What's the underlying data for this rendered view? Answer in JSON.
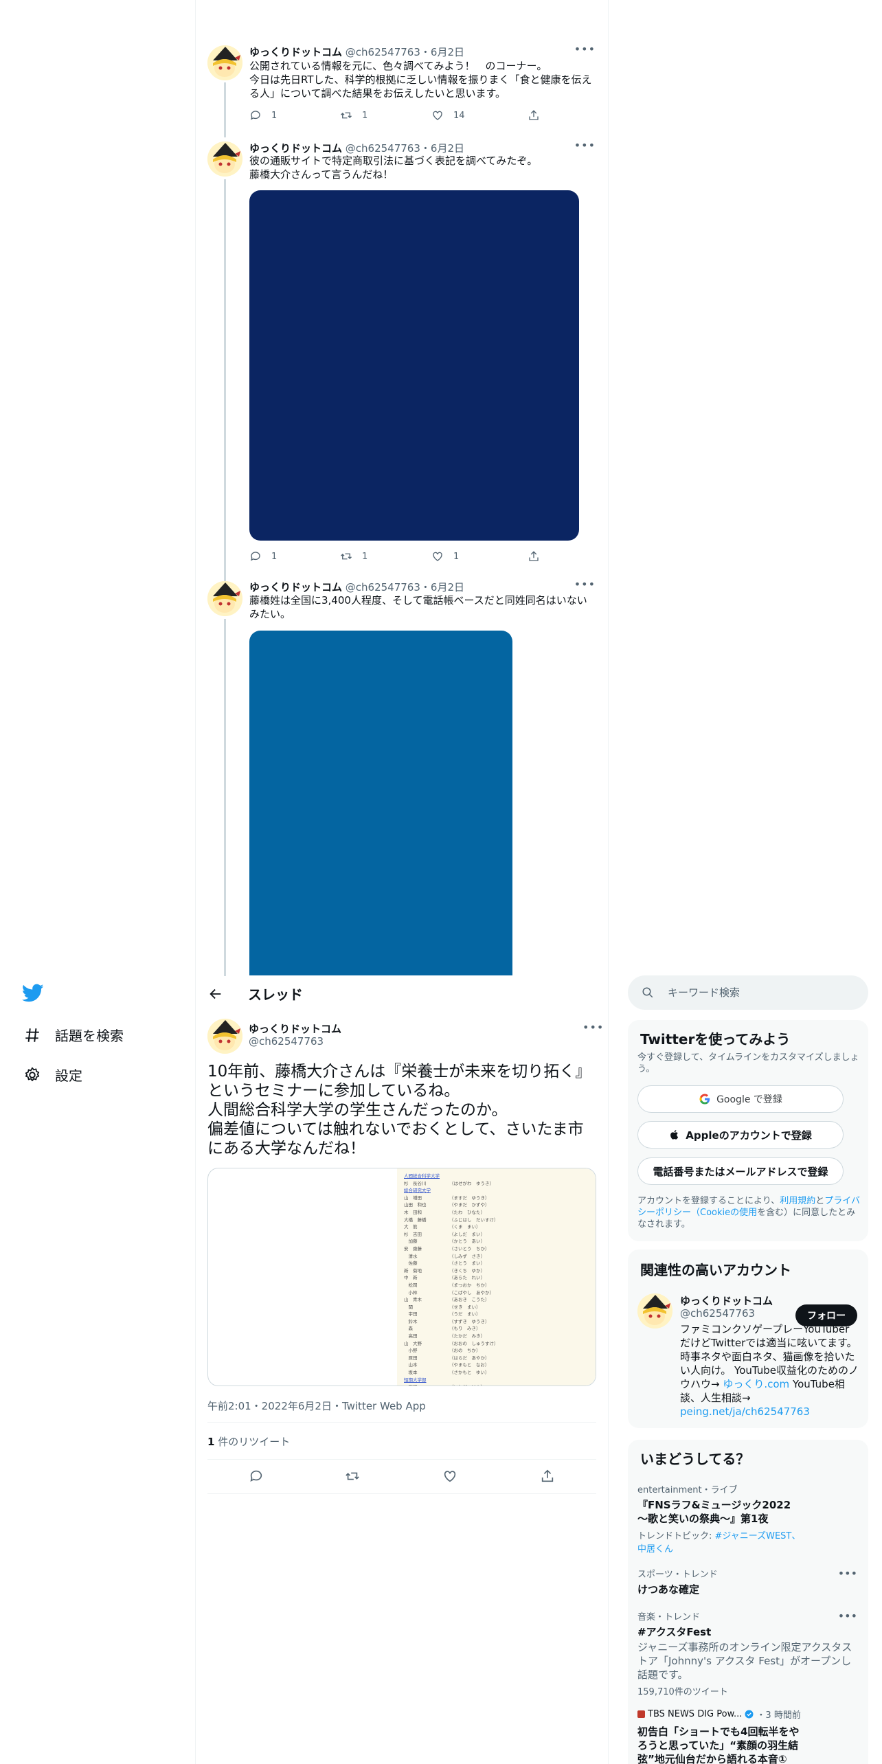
{
  "tweets": [
    {
      "name": "ゆっくりドットコム",
      "meta": "@ch62547763・6月2日",
      "text": "公開されている情報を元に、色々調べてみよう！　のコーナー。\n今日は先日RTした、科学的根拠に乏しい情報を振りまく「食と健康を伝える人」について調べた結果をお伝えしたいと思います。",
      "replies": "1",
      "retweets": "1",
      "likes": "14"
    },
    {
      "name": "ゆっくりドットコム",
      "meta": "@ch62547763・6月2日",
      "text": "彼の通販サイトで特定商取引法に基づく表記を調べてみたぞ。\n藤橋大介さんって言うんだね！",
      "replies": "1",
      "retweets": "1",
      "likes": "1",
      "media_color": "#0b2562"
    },
    {
      "name": "ゆっくりドットコム",
      "meta": "@ch62547763・6月2日",
      "text": "藤橋姓は全国に3,400人程度、そして電話帳ベースだと同姓同名はいないみたい。",
      "media_color": "#0465a1"
    }
  ],
  "nav": {
    "explore": "話題を検索",
    "settings": "設定"
  },
  "thread": {
    "title": "スレッド",
    "author_name": "ゆっくりドットコム",
    "author_handle": "@ch62547763",
    "text": "10年前、藤橋大介さんは『栄養士が未来を切り拓く』というセミナーに参加しているね。\n人間総合科学大学の学生さんだったのか。\n偏差値については触れないでおくとして、さいたま市にある大学なんだね！",
    "timestamp": "午前2:01・2022年6月2日・Twitter Web App",
    "retweet_count": "1",
    "retweet_label": " 件のリツイート"
  },
  "search": {
    "placeholder": "キーワード検索"
  },
  "signup": {
    "title": "Twitterを使ってみよう",
    "subtitle": "今すぐ登録して、タイムラインをカスタマイズしましょう。",
    "google": "Google で登録",
    "apple": "Appleのアカウントで登録",
    "phone": "電話番号またはメールアドレスで登録",
    "terms_prefix": "アカウントを登録することにより、",
    "terms": "利用規約",
    "and": "と",
    "privacy": "プライバシーポリシー（Cookieの使用",
    "terms_suffix": "を含む）に同意したとみなされます。"
  },
  "related": {
    "title": "関連性の高いアカウント",
    "name": "ゆっくりドットコム",
    "handle": "@ch62547763",
    "follow": "フォロー",
    "bio_1": "ファミコンクソゲープレーYouTuberだけどTwitterでは適当に呟いてます。時事ネタや面白ネタ、猫画像を拾いたい人向け。 YouTube収益化のためのノウハウ→ ",
    "bio_link1": "ゆっくり.com",
    "bio_2": " YouTube相談、人生相談→ ",
    "bio_link2": "peing.net/ja/ch62547763"
  },
  "trends": {
    "title": "いまどうしてる？",
    "items": [
      {
        "category": "entertainment・ライブ",
        "name": "『FNSラフ&ミュージック2022 〜歌と笑いの祭典〜』第1夜",
        "topic_prefix": "トレンドトピック: ",
        "topic_links": "#ジャニーズWEST、中居くん"
      },
      {
        "category": "スポーツ・トレンド",
        "name": "けつあな確定"
      },
      {
        "category": "音楽・トレンド",
        "name": "#アクスタFest",
        "desc": "ジャニーズ事務所のオンライン限定アクスタストア「Johnny's アクスタ Fest」がオープンし話題です。",
        "count": "159,710件のツイート"
      },
      {
        "source": "TBS NEWS DIG Pow...",
        "time": "・3 時間前",
        "name": "初告白「ショートでも4回転半をやろうと思っていた」“素顔の羽生結弦”地元仙台だから語れる本音①"
      }
    ]
  },
  "doc_rows": [
    [
      "人間総合科学大学",
      ""
    ],
    [
      "杉　長谷川",
      "（はせがわ　ゆうき）"
    ],
    [
      "総合研究大学",
      ""
    ],
    [
      "山　増田",
      "（ますだ　ゆうき）"
    ],
    [
      "山田　和也",
      "（やまだ　かずや）"
    ],
    [
      "木　田和",
      "（たわ　ひなた）"
    ],
    [
      "大橋　藤橋",
      "（ふじはし　だいすけ）"
    ],
    [
      "大　熊",
      "（くま　まい）"
    ],
    [
      "杉　吉田",
      "（よしだ　まい）"
    ],
    [
      "　加藤",
      "（かとう　あい）"
    ],
    [
      "安　齋藤",
      "（さいとう　ちか）"
    ],
    [
      "　清水",
      "（しみず　さき）"
    ],
    [
      "　佐藤",
      "（さとう　まい）"
    ],
    [
      "新　菊地",
      "（きくち　ゆか）"
    ],
    [
      "中　新",
      "（あらた　れい）"
    ],
    [
      "　松岡",
      "（まつおか　ちか）"
    ],
    [
      "　小林",
      "（こばやし　あやか）"
    ],
    [
      "山　青木",
      "（あおき　こうた）"
    ],
    [
      "　関",
      "（せき　まい）"
    ],
    [
      "　宇田",
      "（うだ　まい）"
    ],
    [
      "　鈴木",
      "（すずき　ゆうき）"
    ],
    [
      "　森",
      "（もり　みき）"
    ],
    [
      "　高田",
      "（たかだ　みき）"
    ],
    [
      "山　大野",
      "（おおの　しゅうすけ）"
    ],
    [
      "　小野",
      "（おの　ちか）"
    ],
    [
      "　原田",
      "（はらだ　あやか）"
    ],
    [
      "　山本",
      "（やまもと　なお）"
    ],
    [
      "　坂本",
      "（さかもと　ゆい）"
    ],
    [
      "短期大学部",
      ""
    ],
    [
      "　石田",
      "（いしだ　けん）"
    ]
  ],
  "colors": {
    "accent": "#1d9bf0",
    "text": "#0f1419",
    "muted": "#536471",
    "card_bg": "#f7f9f9",
    "media_dark_navy": "#0b2562",
    "media_blue": "#0465a1"
  }
}
